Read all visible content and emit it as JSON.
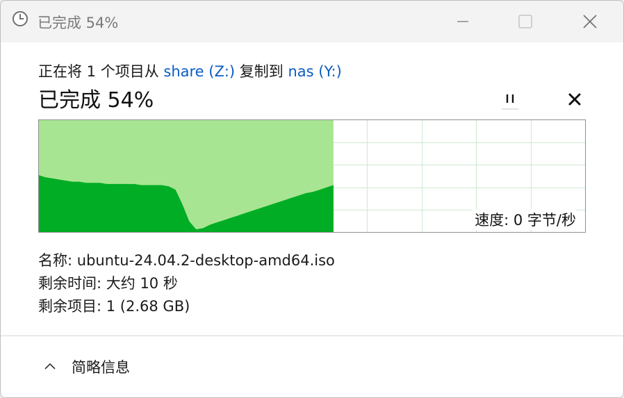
{
  "window": {
    "title": "已完成 54%",
    "icon": "clock-icon",
    "controls": [
      "minimize-icon",
      "maximize-icon",
      "close-icon"
    ]
  },
  "copy_info": {
    "prefix": "正在将 1 个项目从 ",
    "source": "share (Z:)",
    "middle": " 复制到 ",
    "destination": "nas (Y:)"
  },
  "progress": {
    "title": "已完成 54%",
    "percent": 54,
    "pause_icon": "pause-icon",
    "stop_icon": "stop-icon"
  },
  "speed": {
    "label": "速度: 0 字节/秒"
  },
  "details": {
    "name_label": "名称:",
    "name_value": "ubuntu-24.04.2-desktop-amd64.iso",
    "time_label": "剩余时间:",
    "time_value": "大约 10 秒",
    "items_label": "剩余项目:",
    "items_value": "1 (2.68 GB)"
  },
  "footer": {
    "toggle_label": "简略信息",
    "toggle_icon": "chevron-up-icon"
  },
  "colors": {
    "progress_fill": "#a8e593",
    "throughput": "#00ad25",
    "grid": "#cfe8cf",
    "link": "#0a5cc2"
  },
  "chart_data": {
    "type": "area",
    "progress_percent": 54,
    "series": [
      {
        "values": [
          0.51,
          0.49,
          0.48,
          0.47,
          0.46,
          0.45,
          0.45,
          0.44,
          0.44,
          0.44,
          0.43,
          0.43,
          0.43,
          0.43,
          0.43,
          0.42,
          0.42,
          0.42,
          0.42,
          0.41,
          0.38,
          0.25,
          0.1,
          0.03,
          0.04,
          0.07,
          0.09,
          0.11,
          0.13,
          0.15,
          0.17,
          0.19,
          0.21,
          0.23,
          0.25,
          0.27,
          0.29,
          0.31,
          0.33,
          0.35,
          0.36,
          0.38,
          0.4,
          0.42
        ]
      }
    ]
  }
}
